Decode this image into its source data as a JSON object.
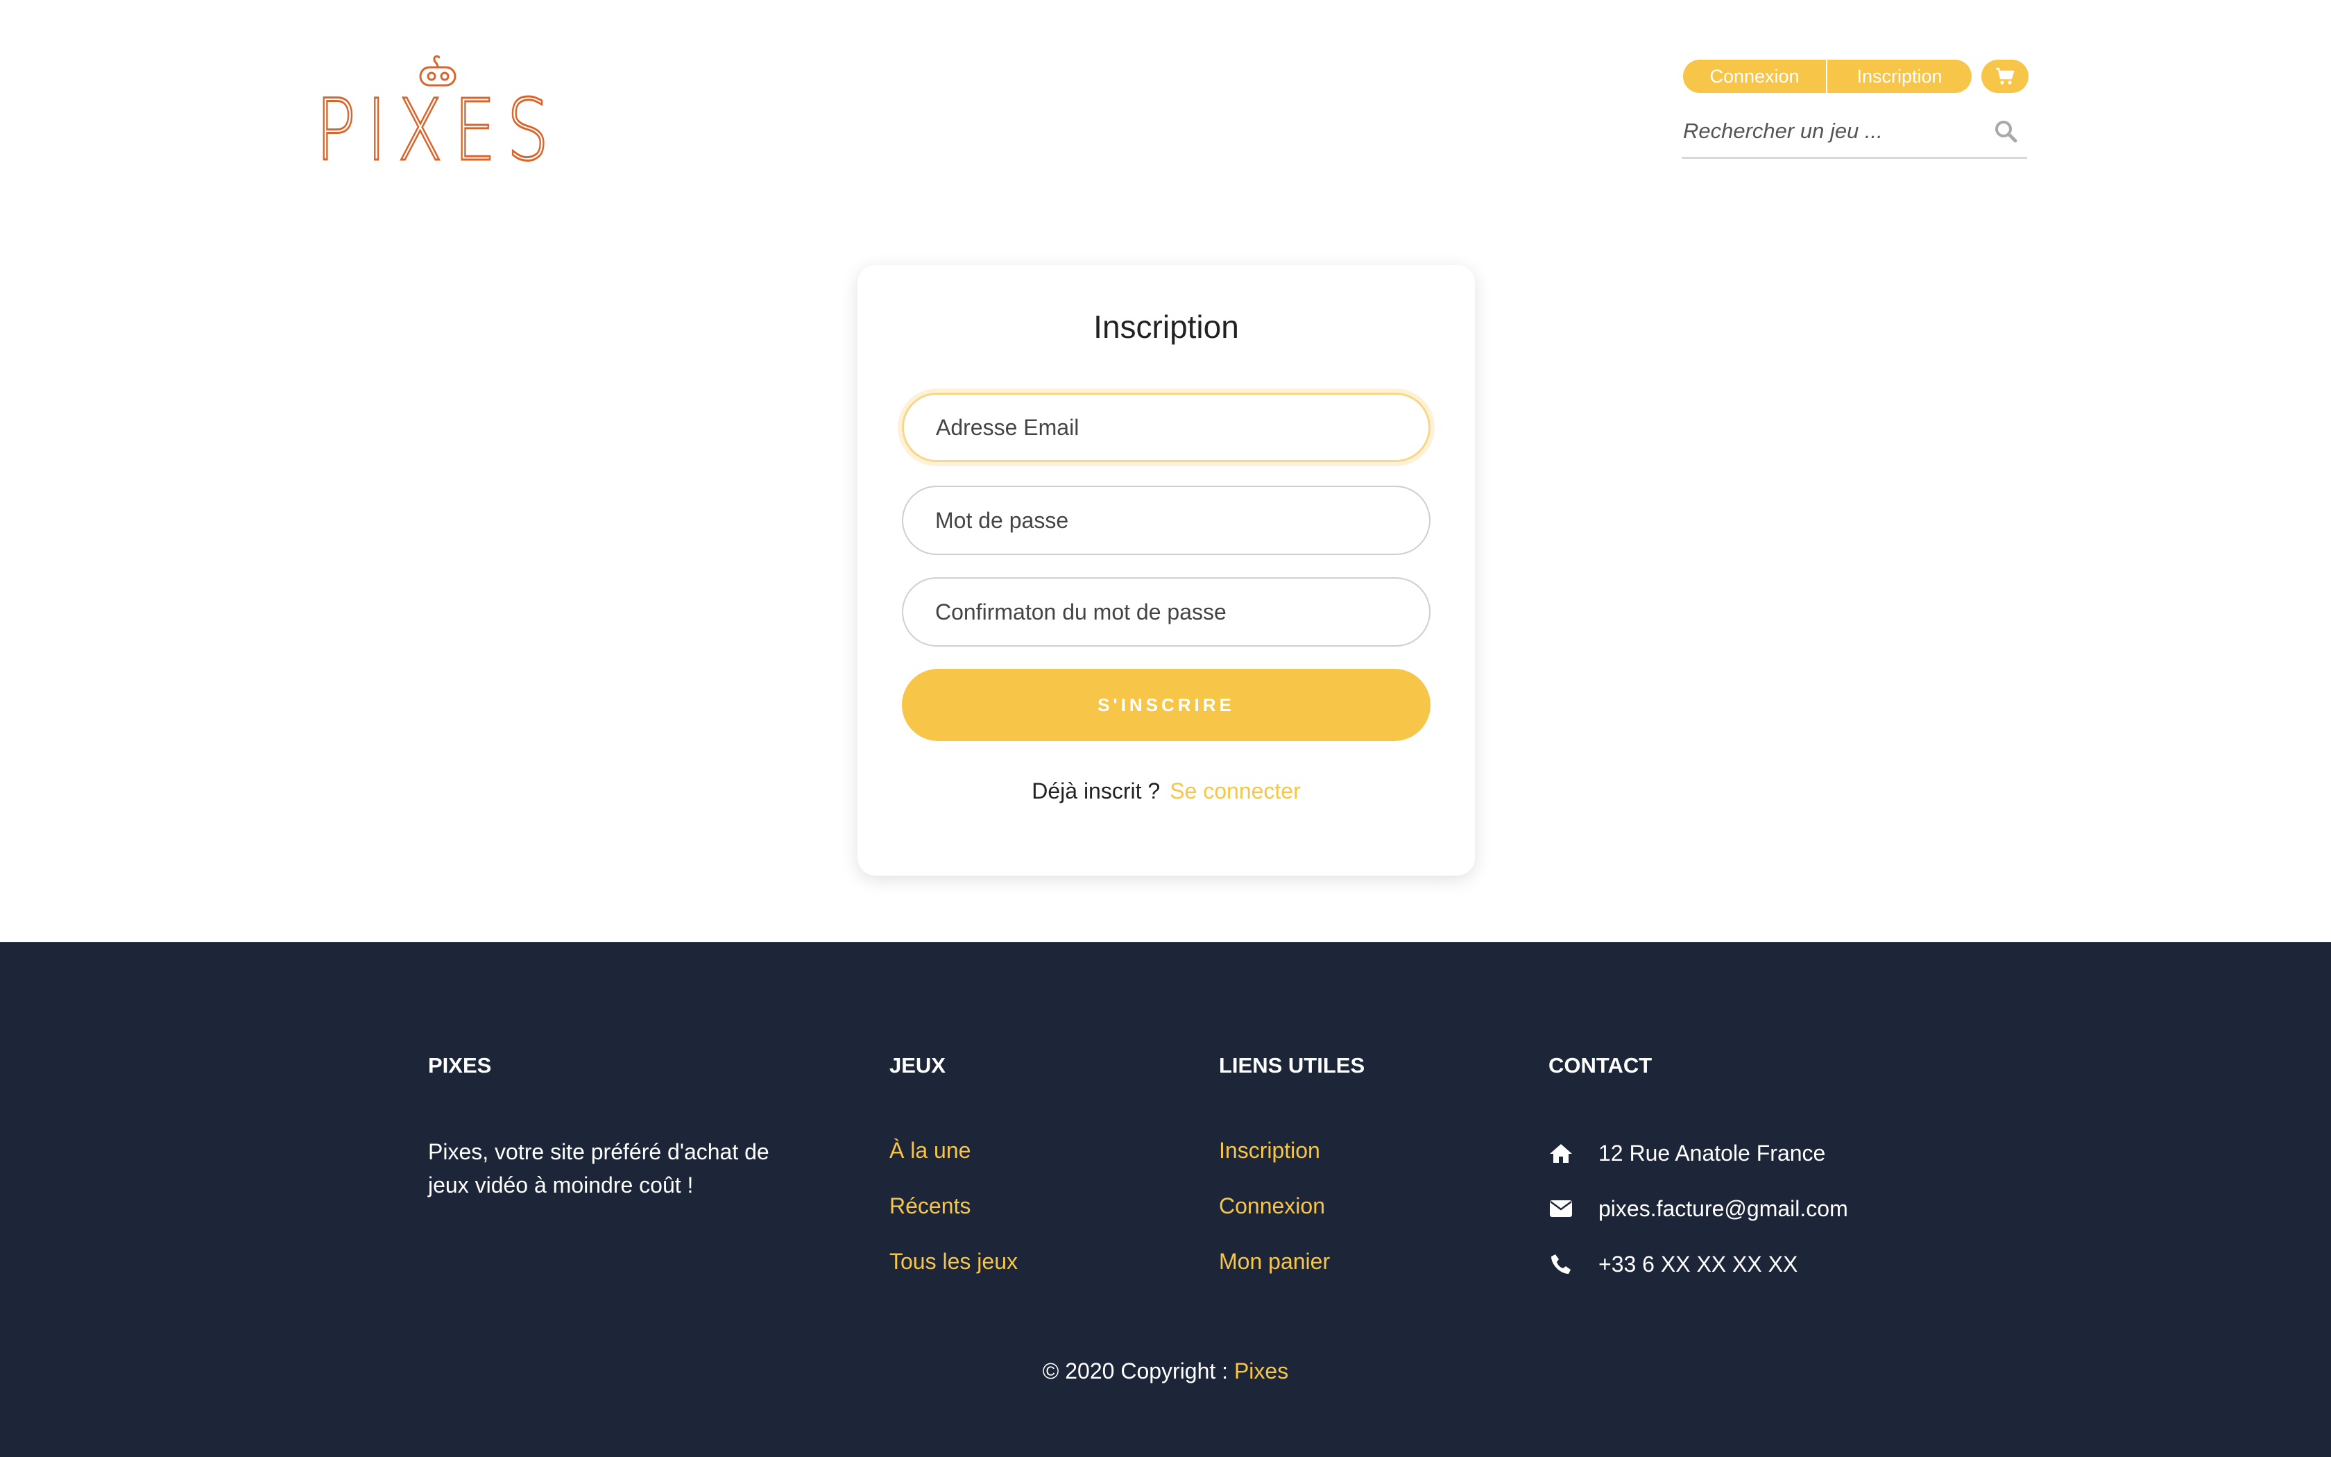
{
  "brand": {
    "logo_text": "PIXES",
    "accent_color": "#f7c548",
    "logo_color": "#d9652b",
    "footer_bg": "#1c2638"
  },
  "header": {
    "login_label": "Connexion",
    "signup_label": "Inscription",
    "cart_icon": "shopping-cart",
    "search_placeholder": "Rechercher un jeu ...",
    "search_icon": "magnifier"
  },
  "form": {
    "title": "Inscription",
    "email_placeholder": "Adresse Email",
    "password_placeholder": "Mot de passe",
    "confirm_placeholder": "Confirmaton du mot de passe",
    "submit_label": "S'INSCRIRE",
    "already_registered": "Déjà inscrit ?",
    "login_link": "Se connecter"
  },
  "footer": {
    "about": {
      "heading": "PIXES",
      "text": "Pixes, votre site préféré d'achat de jeux vidéo à moindre coût !"
    },
    "games": {
      "heading": "JEUX",
      "links": [
        "À la une",
        "Récents",
        "Tous les jeux"
      ]
    },
    "useful": {
      "heading": "LIENS UTILES",
      "links": [
        "Inscription",
        "Connexion",
        "Mon panier"
      ]
    },
    "contact": {
      "heading": "CONTACT",
      "items": [
        {
          "icon": "home",
          "text": "12 Rue Anatole France"
        },
        {
          "icon": "envelope",
          "text": "pixes.facture@gmail.com"
        },
        {
          "icon": "phone",
          "text": "+33 6 XX XX XX XX"
        }
      ]
    },
    "copyright_prefix": "© 2020 Copyright : ",
    "copyright_brand": "Pixes"
  }
}
